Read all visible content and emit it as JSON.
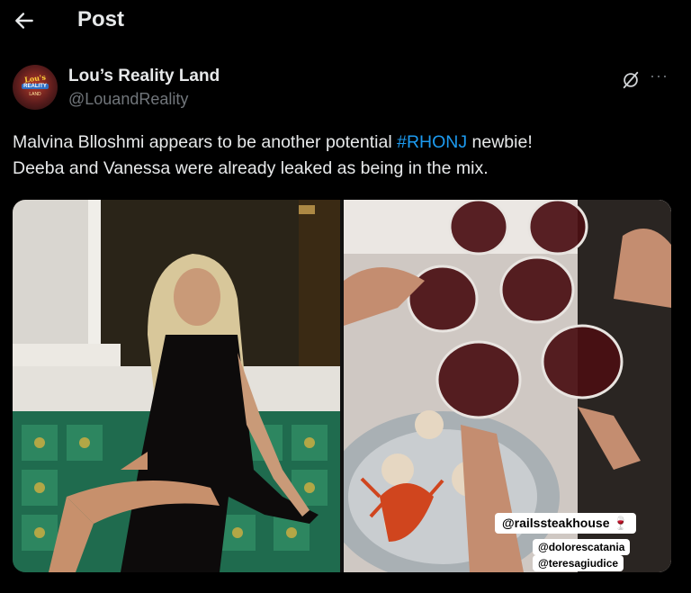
{
  "header": {
    "title": "Post",
    "back_icon": "arrow-left-icon"
  },
  "author": {
    "display_name": "Lou’s Reality Land",
    "handle": "@LouandReality",
    "avatar": {
      "line1": "Lou's",
      "line2": "REALITY",
      "line3": "LAND"
    }
  },
  "actions": {
    "grok_icon": "grok-icon",
    "more_label": "···"
  },
  "post": {
    "text_before": "Malvina Blloshmi appears to be another potential ",
    "hashtag": "#RHONJ",
    "text_after": " newbie!",
    "line2": "Deeba and Vanessa were already leaked as being in the mix."
  },
  "media": {
    "right_tags": {
      "main": "@railssteakhouse 🍷",
      "tag1": "@dolorescatania",
      "tag2": "@teresagiudice"
    }
  },
  "colors": {
    "background": "#000000",
    "text": "#e7e9ea",
    "muted": "#71767b",
    "accent": "#1d9bf0"
  }
}
